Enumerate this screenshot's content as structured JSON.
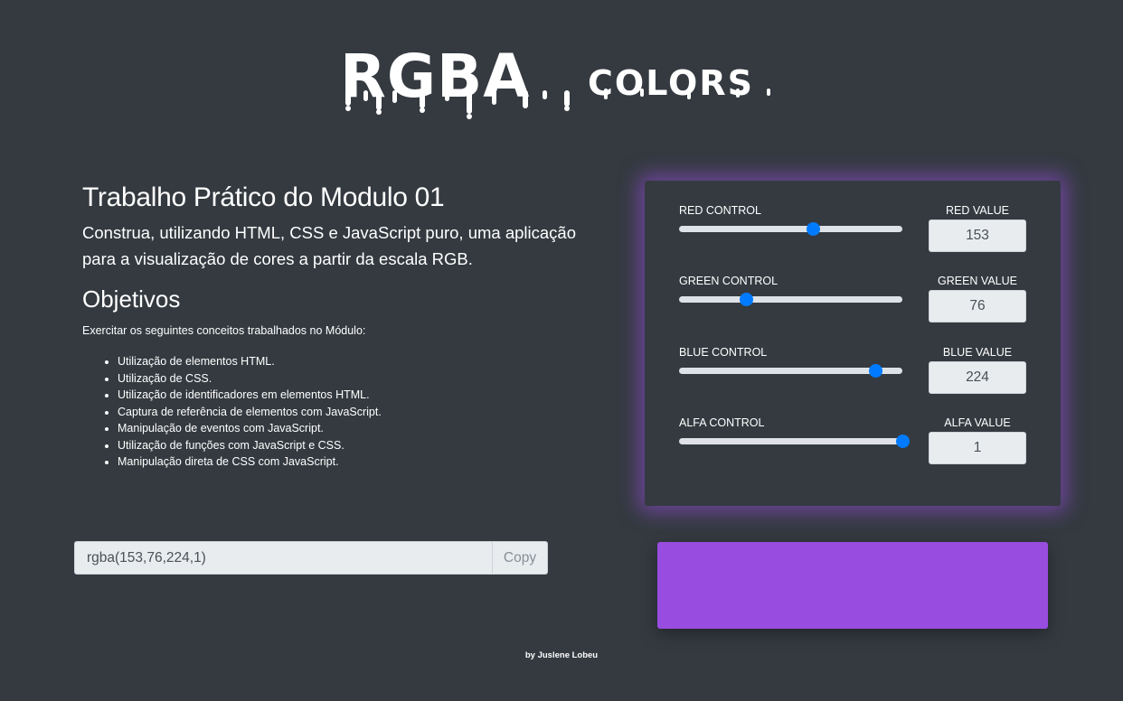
{
  "logo": {
    "main": "RGBA",
    "sub": "COLORS"
  },
  "intro": {
    "title": "Trabalho Prático do Modulo 01",
    "lead": "Construa, utilizando HTML, CSS e JavaScript puro, uma aplicação para a visualização de cores a partir da escala RGB.",
    "objectives_title": "Objetivos",
    "objectives_intro": "Exercitar os seguintes conceitos trabalhados no Módulo:",
    "objectives": [
      "Utilização de elementos HTML.",
      "Utilização de CSS.",
      "Utilização de identificadores em elementos HTML.",
      "Captura de referência de elementos com JavaScript.",
      "Manipulação de eventos com JavaScript.",
      "Utilização de funções com JavaScript e CSS.",
      "Manipulação direta de CSS com JavaScript."
    ]
  },
  "controls": {
    "red": {
      "control_label": "RED CONTROL",
      "value_label": "RED VALUE",
      "value": "153",
      "fraction": 0.6
    },
    "green": {
      "control_label": "GREEN CONTROL",
      "value_label": "GREEN VALUE",
      "value": "76",
      "fraction": 0.298
    },
    "blue": {
      "control_label": "BLUE CONTROL",
      "value_label": "BLUE VALUE",
      "value": "224",
      "fraction": 0.878
    },
    "alpha": {
      "control_label": "ALFA CONTROL",
      "value_label": "ALFA VALUE",
      "value": "1",
      "fraction": 1.0
    }
  },
  "output": {
    "value": "rgba(153,76,224,1)",
    "copy_label": "Copy"
  },
  "preview_color": "#994ce0",
  "accent_color": "#007bff",
  "footer": "by Juslene Lobeu"
}
